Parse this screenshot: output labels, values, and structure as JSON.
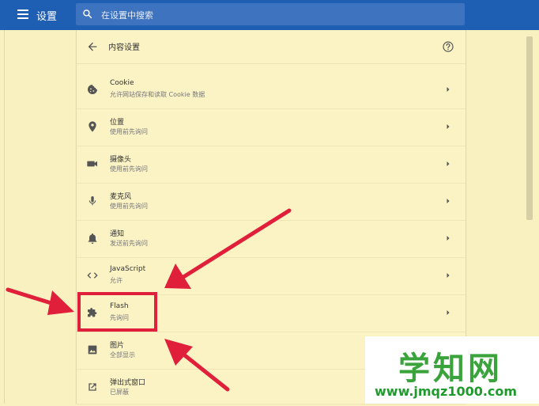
{
  "header": {
    "app_title": "设置",
    "search_placeholder": "在设置中搜索",
    "color": "#1e5fb4"
  },
  "page": {
    "title": "内容设置"
  },
  "items": [
    {
      "label": "Cookie",
      "sub": "允许网站保存和读取 Cookie 数据",
      "icon": "cookie-icon"
    },
    {
      "label": "位置",
      "sub": "使用前先询问",
      "icon": "location-pin-icon"
    },
    {
      "label": "摄像头",
      "sub": "使用前先询问",
      "icon": "camera-icon"
    },
    {
      "label": "麦克风",
      "sub": "使用前先询问",
      "icon": "microphone-icon"
    },
    {
      "label": "通知",
      "sub": "发送前先询问",
      "icon": "bell-icon"
    },
    {
      "label": "JavaScript",
      "sub": "允许",
      "icon": "code-icon"
    },
    {
      "label": "Flash",
      "sub": "先询问",
      "icon": "puzzle-icon"
    },
    {
      "label": "图片",
      "sub": "全部显示",
      "icon": "image-icon"
    },
    {
      "label": "弹出式窗口",
      "sub": "已屏蔽",
      "icon": "external-link-icon"
    }
  ],
  "annotation": {
    "highlight_color": "#e01f3a",
    "highlighted_item": "Flash"
  },
  "watermark": {
    "title": "学知网",
    "url": "www.jmqz1000.com",
    "color": "#3aa33c"
  }
}
